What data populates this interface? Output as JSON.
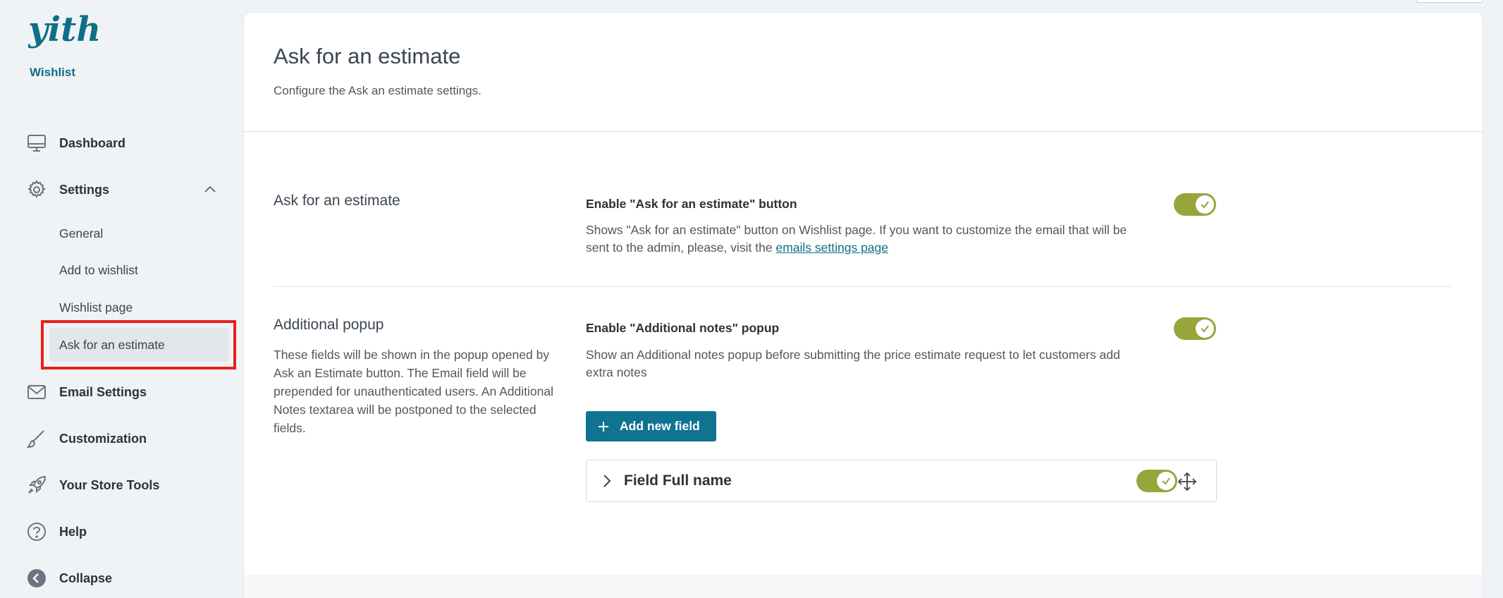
{
  "brand": {
    "logo_text": "yith",
    "caption": "Wishlist",
    "color": "#0f6f87"
  },
  "sidebar": {
    "items": [
      {
        "label": "Dashboard",
        "icon": "monitor-icon"
      },
      {
        "label": "Settings",
        "icon": "gear-icon",
        "expanded": true
      },
      {
        "label": "Email Settings",
        "icon": "envelope-icon"
      },
      {
        "label": "Customization",
        "icon": "brush-icon"
      },
      {
        "label": "Your Store Tools",
        "icon": "rocket-icon"
      },
      {
        "label": "Help",
        "icon": "question-circle-icon"
      },
      {
        "label": "Collapse",
        "icon": "arrow-left-circle-icon"
      }
    ],
    "settings_subitems": [
      {
        "label": "General"
      },
      {
        "label": "Add to wishlist"
      },
      {
        "label": "Wishlist page"
      },
      {
        "label": "Ask for an estimate",
        "active": true
      }
    ],
    "highlight_color": "#e2231a"
  },
  "page": {
    "title": "Ask for an estimate",
    "description": "Configure the Ask an estimate settings."
  },
  "sections": {
    "estimate": {
      "title": "Ask for an estimate",
      "option_label": "Enable \"Ask for an estimate\" button",
      "option_desc_prefix": "Shows \"Ask for an estimate\" button on Wishlist page. If you want to customize the email that will be sent to the admin, please, visit the ",
      "option_desc_link": "emails settings page",
      "enabled": true
    },
    "popup": {
      "title": "Additional popup",
      "description": "These fields will be shown in the popup opened by Ask an Estimate button. The Email field will be prepended for unauthenticated users. An Additional Notes textarea will be postponed to the selected fields.",
      "option_label": "Enable \"Additional notes\" popup",
      "option_desc": "Show an Additional notes popup before submitting the price estimate request to let customers add extra notes",
      "enabled": true,
      "add_button_label": "Add new field",
      "fields": [
        {
          "title": "Field Full name",
          "enabled": true
        }
      ]
    }
  },
  "colors": {
    "toggle_on": "#97a53a",
    "primary_button": "#0f7391"
  }
}
